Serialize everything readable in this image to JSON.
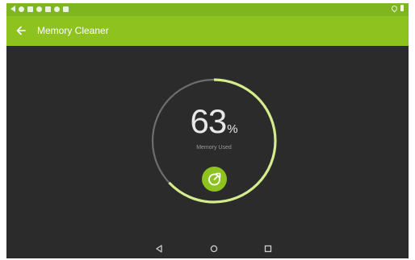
{
  "app": {
    "title": "Memory Cleaner"
  },
  "gauge": {
    "percent_value": "63",
    "percent_unit": "%",
    "caption": "Memory Used",
    "fill_fraction": 0.63,
    "track_color": "#6e6e6e",
    "fill_color": "#d4ec8c"
  },
  "clean_button": {
    "icon": "boost-icon",
    "color": "#8dc21f"
  },
  "colors": {
    "accent": "#8dc21f",
    "status_bar": "#7fb51f",
    "background": "#2b2b2b"
  },
  "icons": {
    "back": "back-arrow-icon",
    "nav_back": "triangle-back-icon",
    "nav_home": "circle-home-icon",
    "nav_recents": "square-recents-icon"
  }
}
